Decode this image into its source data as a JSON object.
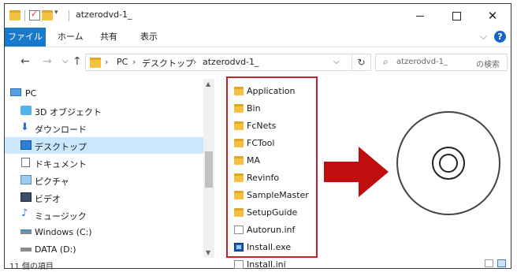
{
  "window": {
    "title": "atzerodvd-1_"
  },
  "ribbon": {
    "tabs": [
      "ファイル",
      "ホーム",
      "共有",
      "表示"
    ]
  },
  "address": {
    "crumbs": [
      "PC",
      "デスクトップ",
      "atzerodvd-1_"
    ],
    "search_placeholder_start": "atzerodvd-1_",
    "search_placeholder_end": "の検索"
  },
  "nav_pane": {
    "items": [
      {
        "label": "PC",
        "icon": "pc-icon",
        "selected": false
      },
      {
        "label": "3D オブジェクト",
        "icon": "3d-objects-icon",
        "selected": false
      },
      {
        "label": "ダウンロード",
        "icon": "download-icon",
        "selected": false
      },
      {
        "label": "デスクトップ",
        "icon": "desktop-icon",
        "selected": true
      },
      {
        "label": "ドキュメント",
        "icon": "documents-icon",
        "selected": false
      },
      {
        "label": "ピクチャ",
        "icon": "pictures-icon",
        "selected": false
      },
      {
        "label": "ビデオ",
        "icon": "videos-icon",
        "selected": false
      },
      {
        "label": "ミュージック",
        "icon": "music-icon",
        "selected": false
      },
      {
        "label": "Windows (C:)",
        "icon": "drive-c-icon",
        "selected": false
      },
      {
        "label": "DATA (D:)",
        "icon": "drive-d-icon",
        "selected": false
      }
    ]
  },
  "files": [
    {
      "name": "Application",
      "icon": "folder-icon"
    },
    {
      "name": "Bin",
      "icon": "folder-icon"
    },
    {
      "name": "FcNets",
      "icon": "folder-icon"
    },
    {
      "name": "FCTool",
      "icon": "folder-icon"
    },
    {
      "name": "MA",
      "icon": "folder-icon"
    },
    {
      "name": "Revinfo",
      "icon": "folder-icon"
    },
    {
      "name": "SampleMaster",
      "icon": "folder-icon"
    },
    {
      "name": "SetupGuide",
      "icon": "folder-icon"
    },
    {
      "name": "Autorun.inf",
      "icon": "settings-file-icon"
    },
    {
      "name": "Install.exe",
      "icon": "installer-icon"
    },
    {
      "name": "Install.ini",
      "icon": "settings-file-icon"
    }
  ],
  "status": {
    "item_count": "11 個の項目"
  },
  "colors": {
    "accent": "#1979ca",
    "highlight_box": "#c8202b",
    "arrow": "#c00d0d",
    "selection": "#cce8ff",
    "folder": "#f4c241"
  }
}
